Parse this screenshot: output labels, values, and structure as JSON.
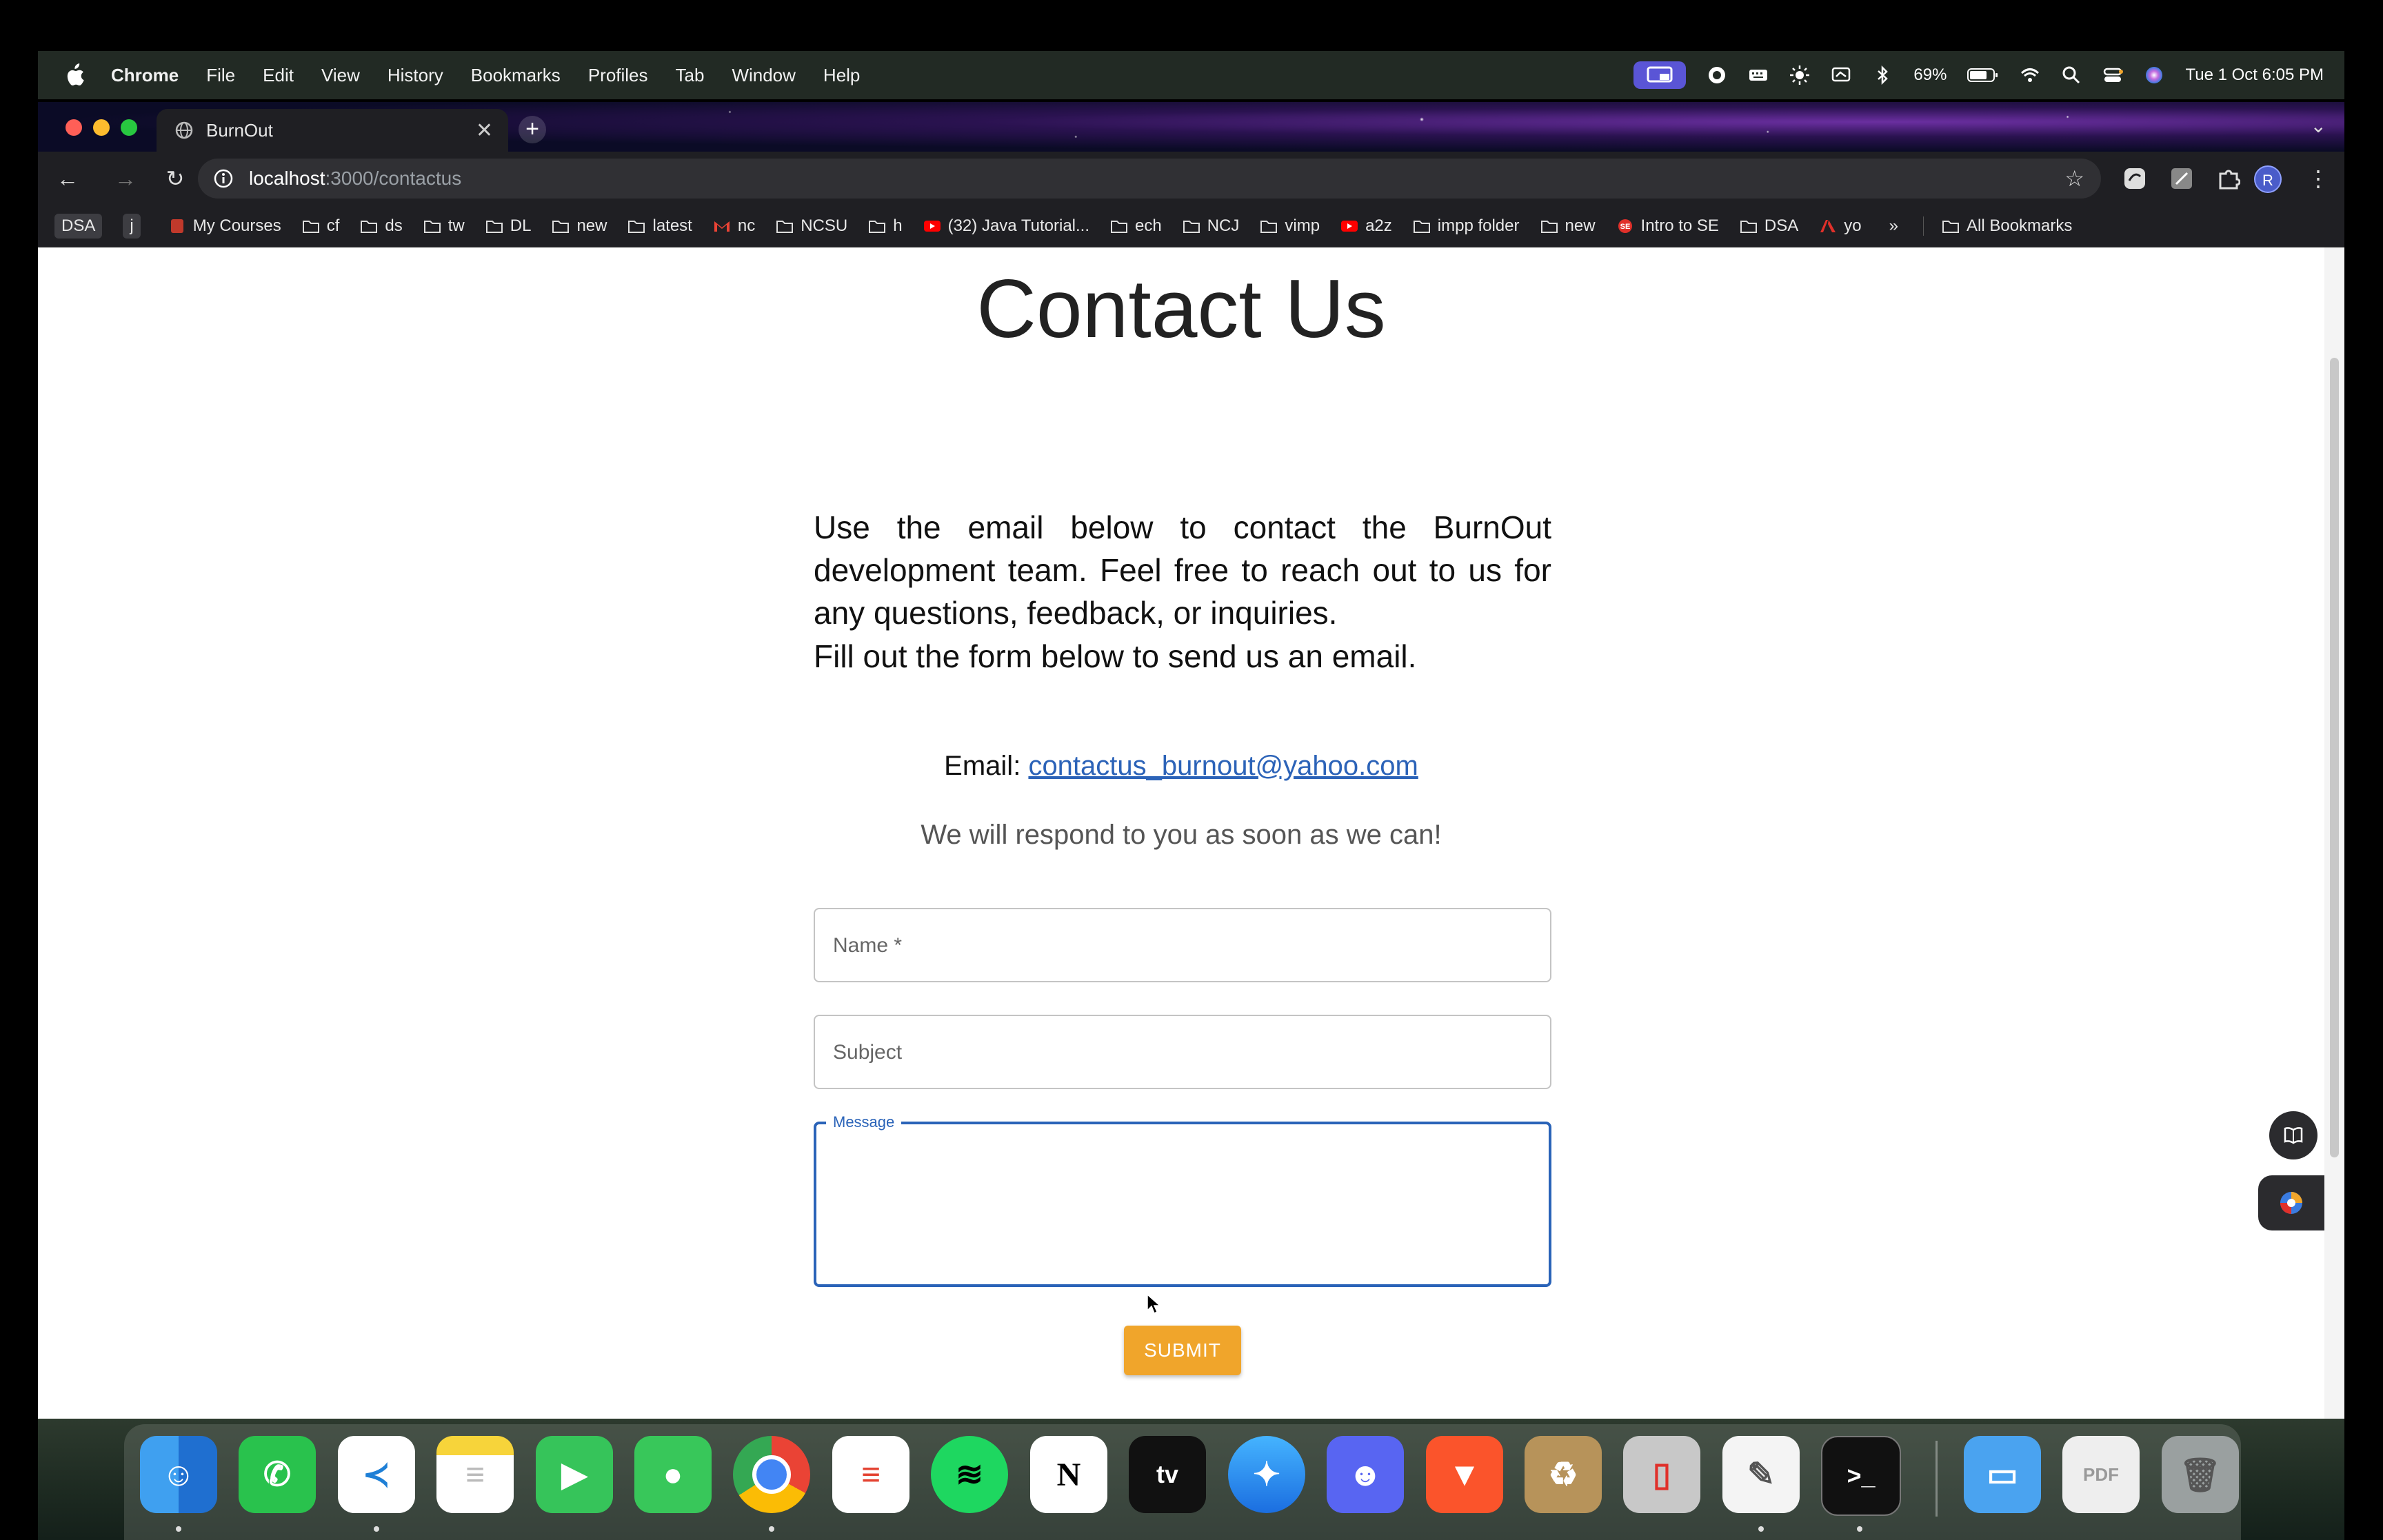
{
  "menubar": {
    "items": [
      "Chrome",
      "File",
      "Edit",
      "View",
      "History",
      "Bookmarks",
      "Profiles",
      "Tab",
      "Window",
      "Help"
    ],
    "battery": "69%",
    "datetime": "Tue 1 Oct  6:05 PM"
  },
  "browser": {
    "tab_title": "BurnOut",
    "url_host": "localhost",
    "url_path": ":3000/contactus",
    "profile_initial": "R"
  },
  "bookmarks": [
    {
      "label": "DSA",
      "icon": "badge"
    },
    {
      "label": "j",
      "icon": "badge"
    },
    {
      "label": "My Courses",
      "icon": "course-icon"
    },
    {
      "label": "cf",
      "icon": "folder-icon"
    },
    {
      "label": "ds",
      "icon": "folder-icon"
    },
    {
      "label": "tw",
      "icon": "folder-icon"
    },
    {
      "label": "DL",
      "icon": "folder-icon"
    },
    {
      "label": "new",
      "icon": "folder-icon"
    },
    {
      "label": "latest",
      "icon": "folder-icon"
    },
    {
      "label": "nc",
      "icon": "gmail-icon"
    },
    {
      "label": "NCSU",
      "icon": "folder-icon"
    },
    {
      "label": "h",
      "icon": "folder-icon"
    },
    {
      "label": "(32) Java Tutorial...",
      "icon": "youtube-icon"
    },
    {
      "label": "ech",
      "icon": "folder-icon"
    },
    {
      "label": "NCJ",
      "icon": "folder-icon"
    },
    {
      "label": "vimp",
      "icon": "folder-icon"
    },
    {
      "label": "a2z",
      "icon": "youtube-icon"
    },
    {
      "label": "impp folder",
      "icon": "folder-icon"
    },
    {
      "label": "new",
      "icon": "folder-icon"
    },
    {
      "label": "Intro to SE",
      "icon": "se-icon"
    },
    {
      "label": "DSA",
      "icon": "folder-icon"
    },
    {
      "label": "yo",
      "icon": "adobe-icon"
    }
  ],
  "bookmarks_overflow": "»",
  "all_bookmarks": "All Bookmarks",
  "page": {
    "title": "Contact Us",
    "intro": "Use the email below to contact the BurnOut development team. Feel free to reach out to us for any questions, feedback, or inquiries.",
    "form_intro": "Fill out the form below to send us an email.",
    "email_label": "Email:",
    "email_address": "contactus_burnout@yahoo.com",
    "respond_note": "We will respond to you as soon as we can!",
    "form": {
      "name_placeholder": "Name *",
      "subject_placeholder": "Subject",
      "message_label": "Message",
      "submit_label": "SUBMIT"
    }
  },
  "colors": {
    "link": "#2c63b8",
    "focus": "#2a63b8",
    "submit": "#f0a52b"
  },
  "dock": [
    "finder",
    "whatsapp",
    "vscode",
    "notes",
    "facetime",
    "messages",
    "chrome",
    "todoist",
    "spotify",
    "notion",
    "apple-tv",
    "safari",
    "discord",
    "brave",
    "archive-utility",
    "iphone-mirroring",
    "textedit",
    "terminal",
    "files",
    "pdf-document",
    "trash"
  ]
}
